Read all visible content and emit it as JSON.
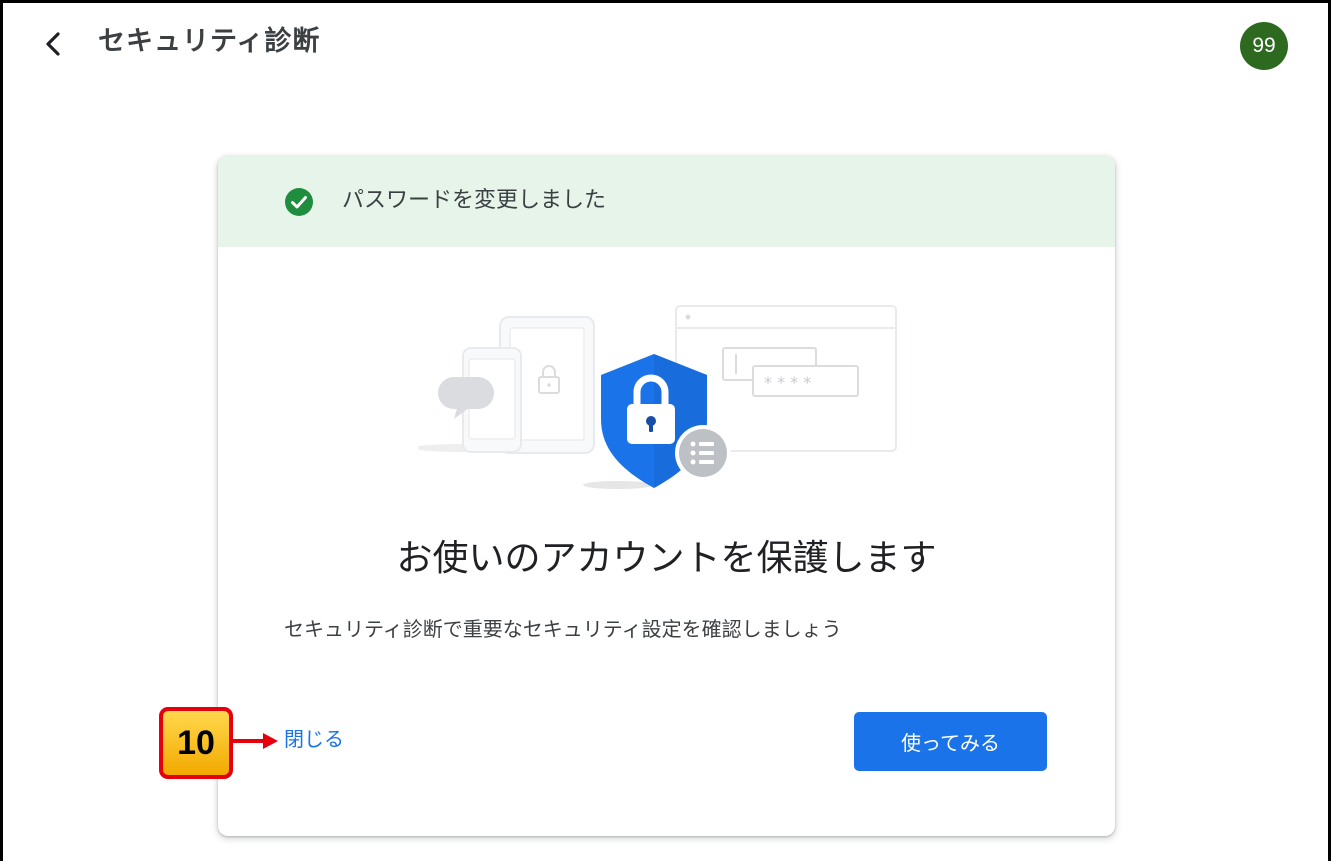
{
  "header": {
    "back_icon": "chevron-left-icon",
    "title": "セキュリティ診断",
    "avatar_text": "99",
    "avatar_color": "#2d6a1f"
  },
  "banner": {
    "icon": "check-circle-icon",
    "text": "パスワードを変更しました",
    "background": "#e6f4ea",
    "icon_color": "#1e8e3e"
  },
  "illustration": {
    "icon": "security-shield-illustration",
    "password_mask": "* * * *"
  },
  "card": {
    "heading": "お使いのアカウントを保護します",
    "description": "セキュリティ診断で重要なセキュリティ設定を確認しましょう",
    "close_label": "閉じる",
    "primary_label": "使ってみる",
    "accent": "#1a73e8"
  },
  "annotation": {
    "step_number": "10",
    "badge_color": "#f2a900",
    "border_color": "#e5000b"
  }
}
